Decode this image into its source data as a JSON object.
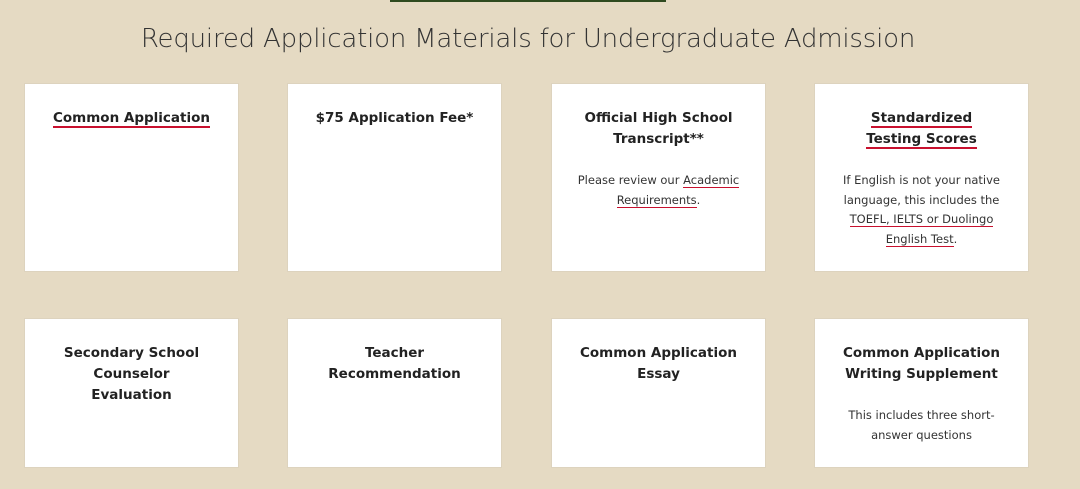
{
  "page_title": "Required Application Materials for Undergraduate Admission",
  "cards": [
    {
      "title": "Common Application"
    },
    {
      "title": "$75 Application Fee*"
    },
    {
      "title": "Official High School Transcript**",
      "desc_before": "Please review our ",
      "link": "Academic Requirements",
      "desc_after": "."
    },
    {
      "title": "Standardized Testing Scores",
      "desc_before": "If English is not your native language, this includes the ",
      "link": "TOEFL, IELTS or Duolingo English Test",
      "desc_after": "."
    },
    {
      "title": "Secondary School Counselor Evaluation"
    },
    {
      "title": "Teacher Recommendation"
    },
    {
      "title": "Common Application Essay"
    },
    {
      "title": "Common Application Writing Supplement",
      "desc": "This includes three short-answer questions"
    }
  ],
  "colors": {
    "background": "#e5dac3",
    "card": "#ffffff",
    "link_underline": "#c8102e",
    "top_rule": "#2f4a1f"
  }
}
